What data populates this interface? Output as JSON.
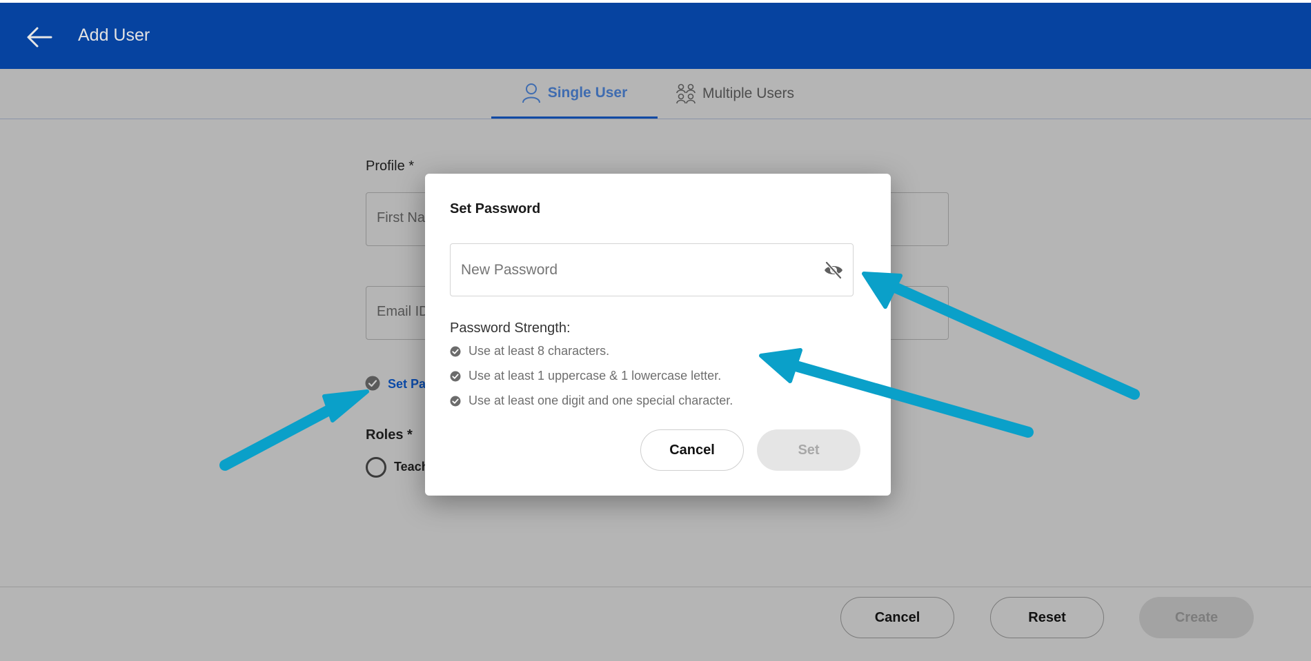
{
  "header": {
    "title": "Add User",
    "back_icon": "arrow-left-icon",
    "color": "#0643a0"
  },
  "tabs": [
    {
      "label": "Single User",
      "icon": "user-icon",
      "active": true
    },
    {
      "label": "Multiple Users",
      "icon": "users-icon",
      "active": false
    }
  ],
  "form": {
    "profile_label": "Profile *",
    "first_name_placeholder": "First Na",
    "email_placeholder": "Email ID",
    "set_password_link": "Set Pas",
    "roles_label": "Roles *",
    "role_option": "Teach"
  },
  "footer": {
    "cancel": "Cancel",
    "reset": "Reset",
    "create": "Create"
  },
  "dialog": {
    "title": "Set Password",
    "password_placeholder": "New Password",
    "eye_icon": "eye-slash-icon",
    "strength_title": "Password Strength:",
    "rules": [
      "Use at least 8 characters.",
      "Use at least 1 uppercase & 1 lowercase letter.",
      "Use at least one digit and one special character."
    ],
    "cancel": "Cancel",
    "set": "Set"
  },
  "annotation_color": "#0aa0c9"
}
